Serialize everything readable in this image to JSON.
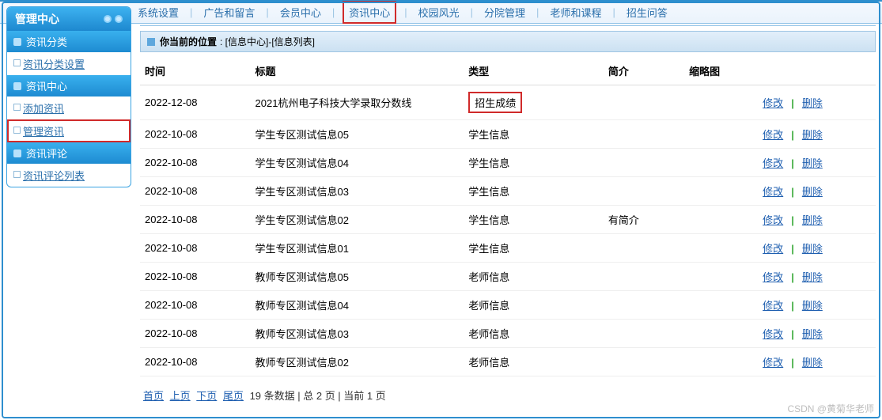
{
  "topnav": {
    "items": [
      "系统设置",
      "广告和留言",
      "会员中心",
      "资讯中心",
      "校园风光",
      "分院管理",
      "老师和课程",
      "招生问答"
    ],
    "highlight_index": 3
  },
  "sidebar": {
    "title": "管理中心",
    "sections": [
      {
        "label": "资讯分类",
        "items": [
          {
            "label": "资讯分类设置",
            "hl": false
          }
        ]
      },
      {
        "label": "资讯中心",
        "items": [
          {
            "label": "添加资讯",
            "hl": false
          },
          {
            "label": "管理资讯",
            "hl": true
          }
        ]
      },
      {
        "label": "资讯评论",
        "items": [
          {
            "label": "资讯评论列表",
            "hl": false
          }
        ]
      }
    ]
  },
  "location": {
    "prefix": "你当前的位置",
    "path": ": [信息中心]-[信息列表]"
  },
  "table": {
    "headers": [
      "时间",
      "标题",
      "类型",
      "简介",
      "缩略图",
      ""
    ],
    "actions": {
      "edit": "修改",
      "delete": "删除"
    },
    "rows": [
      {
        "date": "2022-12-08",
        "title": "2021杭州电子科技大学录取分数线",
        "type": "招生成绩",
        "type_hl": true,
        "summary": "",
        "thumb": ""
      },
      {
        "date": "2022-10-08",
        "title": "学生专区测试信息05",
        "type": "学生信息",
        "type_hl": false,
        "summary": "",
        "thumb": ""
      },
      {
        "date": "2022-10-08",
        "title": "学生专区测试信息04",
        "type": "学生信息",
        "type_hl": false,
        "summary": "",
        "thumb": ""
      },
      {
        "date": "2022-10-08",
        "title": "学生专区测试信息03",
        "type": "学生信息",
        "type_hl": false,
        "summary": "",
        "thumb": ""
      },
      {
        "date": "2022-10-08",
        "title": "学生专区测试信息02",
        "type": "学生信息",
        "type_hl": false,
        "summary": "有简介",
        "thumb": ""
      },
      {
        "date": "2022-10-08",
        "title": "学生专区测试信息01",
        "type": "学生信息",
        "type_hl": false,
        "summary": "",
        "thumb": ""
      },
      {
        "date": "2022-10-08",
        "title": "教师专区测试信息05",
        "type": "老师信息",
        "type_hl": false,
        "summary": "",
        "thumb": ""
      },
      {
        "date": "2022-10-08",
        "title": "教师专区测试信息04",
        "type": "老师信息",
        "type_hl": false,
        "summary": "",
        "thumb": ""
      },
      {
        "date": "2022-10-08",
        "title": "教师专区测试信息03",
        "type": "老师信息",
        "type_hl": false,
        "summary": "",
        "thumb": ""
      },
      {
        "date": "2022-10-08",
        "title": "教师专区测试信息02",
        "type": "老师信息",
        "type_hl": false,
        "summary": "",
        "thumb": ""
      }
    ]
  },
  "pager": {
    "first": "首页",
    "prev": "上页",
    "next": "下页",
    "last": "尾页",
    "info": "19 条数据 | 总 2 页 | 当前 1 页"
  },
  "watermark": "CSDN @黄菊华老师"
}
